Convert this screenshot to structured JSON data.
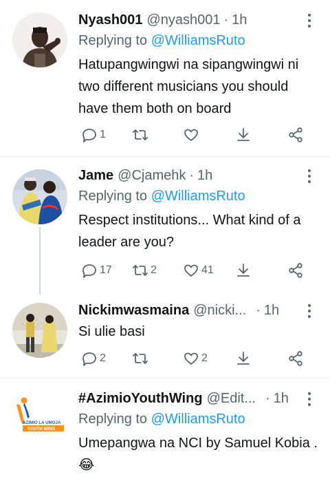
{
  "tweets": [
    {
      "name": "Nyash001",
      "handle": "@nyash001",
      "dot": "·",
      "time": "1h",
      "replying_prefix": "Replying to",
      "replying_to": "@WilliamsRuto",
      "text": "Hatupangwingwi na sipangwingwi ni two different musicians you should have them both on board",
      "reply_count": "1",
      "retweet_count": "",
      "like_count": ""
    },
    {
      "name": "Jame",
      "handle": "@Cjamehk",
      "dot": "·",
      "time": "1h",
      "replying_prefix": "Replying to",
      "replying_to": "@WilliamsRuto",
      "text": "Respect institutions... What kind of a leader are you?",
      "reply_count": "17",
      "retweet_count": "2",
      "like_count": "41"
    },
    {
      "name": "Nickimwasmaina",
      "handle": "@nicki...",
      "dot": "·",
      "time": "1h",
      "text": "Si ulie basi",
      "reply_count": "2",
      "retweet_count": "",
      "like_count": "2"
    },
    {
      "name": "#AzimioYouthWing",
      "handle": "@Edit...",
      "dot": "·",
      "time": "1h",
      "replying_prefix": "Replying to",
      "replying_to": "@WilliamsRuto",
      "text": "Umepangwa na NCI by Samuel Kobia . 😂",
      "avatar_logo_line1": "AZIMIO LA UMOJA",
      "avatar_logo_line2": "YOUTH WING"
    }
  ],
  "icons": {
    "reply": "reply-icon",
    "retweet": "retweet-icon",
    "like": "heart-icon",
    "download": "download-icon",
    "share": "share-icon",
    "more": "more-icon"
  },
  "colors": {
    "link": "#1d9bf0",
    "secondary_text": "#536471",
    "primary_text": "#0f1419",
    "divider": "#eff3f4",
    "logo_orange": "#f7941d",
    "logo_blue": "#1b5fa8"
  }
}
